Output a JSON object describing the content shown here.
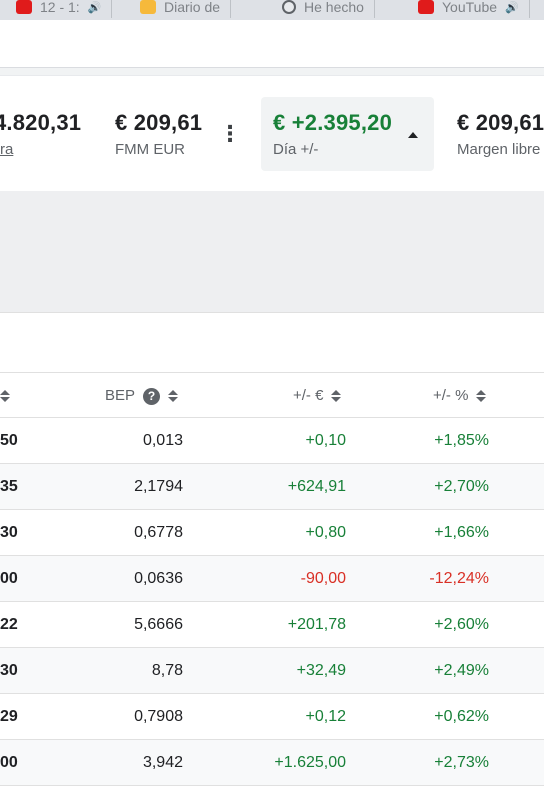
{
  "browser": {
    "tabs": [
      {
        "title": "12 - 1: ",
        "favicon": "red",
        "audio_icon": "audio-playing-icon"
      },
      {
        "title": "Diario de ",
        "favicon": "orange"
      },
      {
        "title": "He hecho",
        "favicon": "grey"
      },
      {
        "title": "YouTube",
        "favicon": "red",
        "audio_icon": "audio-playing-icon"
      }
    ]
  },
  "summary": {
    "cash": {
      "value": "4.820,31",
      "label": "ra"
    },
    "fmm": {
      "value": "€ 209,61",
      "label": "FMM EUR"
    },
    "day": {
      "value": "€ +2.395,20",
      "label": "Día +/-"
    },
    "margin": {
      "value": "€ 209,61",
      "label": "Margen libre"
    }
  },
  "table": {
    "headers": {
      "bep": "BEP",
      "abs": "+/- €",
      "pct": "+/- %"
    },
    "rows": [
      {
        "first": "50",
        "bep": "0,013",
        "abs": "+0,10",
        "pct": "+1,85%",
        "dir": "pos"
      },
      {
        "first": "35",
        "bep": "2,1794",
        "abs": "+624,91",
        "pct": "+2,70%",
        "dir": "pos"
      },
      {
        "first": "30",
        "bep": "0,6778",
        "abs": "+0,80",
        "pct": "+1,66%",
        "dir": "pos"
      },
      {
        "first": "00",
        "bep": "0,0636",
        "abs": "-90,00",
        "pct": "-12,24%",
        "dir": "neg"
      },
      {
        "first": "22",
        "bep": "5,6666",
        "abs": "+201,78",
        "pct": "+2,60%",
        "dir": "pos"
      },
      {
        "first": "30",
        "bep": "8,78",
        "abs": "+32,49",
        "pct": "+2,49%",
        "dir": "pos"
      },
      {
        "first": "29",
        "bep": "0,7908",
        "abs": "+0,12",
        "pct": "+0,62%",
        "dir": "pos"
      },
      {
        "first": "00",
        "bep": "3,942",
        "abs": "+1.625,00",
        "pct": "+2,73%",
        "dir": "pos"
      }
    ]
  },
  "colors": {
    "positive": "#188038",
    "negative": "#d93025"
  }
}
